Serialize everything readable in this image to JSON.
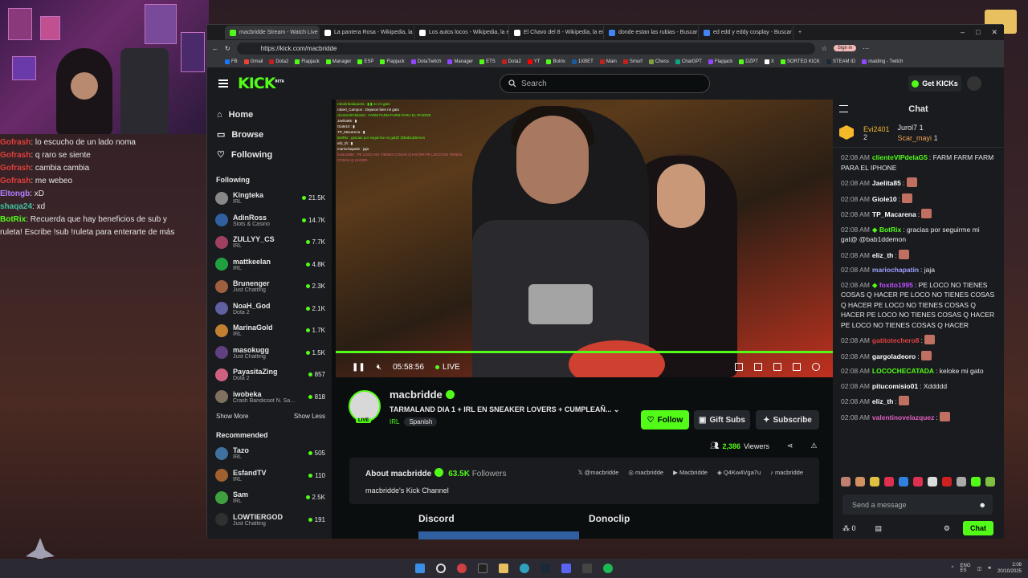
{
  "overlay_chat": [
    {
      "user": "Gofrash",
      "color": "#e0403a",
      "text": "lo escucho de un lado noma"
    },
    {
      "user": "Gofrash",
      "color": "#e0403a",
      "text": "q raro se siente"
    },
    {
      "user": "Gofrash",
      "color": "#e0403a",
      "text": "cambia cambia"
    },
    {
      "user": "Gofrash",
      "color": "#e0403a",
      "text": "me webeo"
    },
    {
      "user": "Eltongb",
      "color": "#b080ff",
      "text": "xD"
    },
    {
      "user": "shaqa24",
      "color": "#40c0a0",
      "text": "xd"
    },
    {
      "user": "BotRix",
      "color": "#53fc18",
      "text": "Recuerda que hay beneficios de sub y"
    },
    {
      "user": "",
      "color": "#ffffff",
      "text": "ruleta! Escribe !sub !ruleta para enterarte de más"
    }
  ],
  "browser": {
    "tabs": [
      {
        "label": "macbridde Stream - Watch Live o",
        "color": "#53fc18"
      },
      {
        "label": "La pantera Rosa - Wikipedia, la e",
        "color": "#ffffff"
      },
      {
        "label": "Los autos locos - Wikipedia, la e",
        "color": "#ffffff"
      },
      {
        "label": "El Chavo del 8 - Wikipedia, la en",
        "color": "#ffffff"
      },
      {
        "label": "donde estan las rubias - Buscar c",
        "color": "#4285f4"
      },
      {
        "label": "ed edd y eddy cosplay - Buscar c",
        "color": "#4285f4"
      }
    ],
    "url": "https://kick.com/macbridde",
    "signin": "Sign in",
    "bookmarks": [
      {
        "label": "FB",
        "color": "#1877f2"
      },
      {
        "label": "Gmail",
        "color": "#ea4335"
      },
      {
        "label": "Dota2",
        "color": "#c02020"
      },
      {
        "label": "Flapjack",
        "color": "#53fc18"
      },
      {
        "label": "Manager",
        "color": "#53fc18"
      },
      {
        "label": "ESP",
        "color": "#53fc18"
      },
      {
        "label": "Flapjack",
        "color": "#53fc18"
      },
      {
        "label": "DotaTwitch",
        "color": "#9146ff"
      },
      {
        "label": "Manager",
        "color": "#9146ff"
      },
      {
        "label": "ETS",
        "color": "#53fc18"
      },
      {
        "label": "Dota2",
        "color": "#c02020"
      },
      {
        "label": "YT",
        "color": "#ff0000"
      },
      {
        "label": "Botrix",
        "color": "#53fc18"
      },
      {
        "label": "1XBET",
        "color": "#1a5aa0"
      },
      {
        "label": "Main",
        "color": "#c02020"
      },
      {
        "label": "Smurf",
        "color": "#c02020"
      },
      {
        "label": "Chess",
        "color": "#80a040"
      },
      {
        "label": "ChatGPT",
        "color": "#10a37f"
      },
      {
        "label": "Flapjack",
        "color": "#9146ff"
      },
      {
        "label": "DZPT",
        "color": "#53fc18"
      },
      {
        "label": "X",
        "color": "#ffffff"
      },
      {
        "label": "SORTEO KICK",
        "color": "#53fc18"
      },
      {
        "label": "STEAM ID",
        "color": "#1b2838"
      },
      {
        "label": "malding - Twitch",
        "color": "#9146ff"
      }
    ]
  },
  "kick": {
    "logo": "KICK",
    "logo_beta": "BETA",
    "search_placeholder": "Search",
    "get_kicks": "Get KICKs",
    "nav": [
      {
        "label": "Home",
        "icon": "home-icon"
      },
      {
        "label": "Browse",
        "icon": "browse-icon"
      },
      {
        "label": "Following",
        "icon": "heart-icon"
      }
    ],
    "following_title": "Following",
    "following": [
      {
        "name": "Kingteka",
        "cat": "IRL",
        "count": "21.5K",
        "color": "#888"
      },
      {
        "name": "AdinRoss",
        "cat": "Slots & Casino",
        "count": "14.7K",
        "color": "#3060a0"
      },
      {
        "name": "ZULLYY_CS",
        "cat": "IRL",
        "count": "7.7K",
        "color": "#a04060"
      },
      {
        "name": "mattkeelan",
        "cat": "IRL",
        "count": "4.8K",
        "color": "#20a040"
      },
      {
        "name": "Brunenger",
        "cat": "Just Chatting",
        "count": "2.3K",
        "color": "#a06040"
      },
      {
        "name": "NoaH_God",
        "cat": "Dota 2",
        "count": "2.1K",
        "color": "#6060a0"
      },
      {
        "name": "MarinaGold",
        "cat": "IRL",
        "count": "1.7K",
        "color": "#c08030"
      },
      {
        "name": "masokugg",
        "cat": "Just Chatting",
        "count": "1.5K",
        "color": "#604080"
      },
      {
        "name": "PayasitaZing",
        "cat": "Dota 2",
        "count": "857",
        "color": "#d06080"
      },
      {
        "name": "iwobeka",
        "cat": "Crash Bandicoot N. Sa...",
        "count": "818",
        "color": "#807060"
      }
    ],
    "show_more": "Show More",
    "show_less": "Show Less",
    "recommended_title": "Recommended",
    "recommended": [
      {
        "name": "Tazo",
        "cat": "IRL",
        "count": "505",
        "color": "#4070a0"
      },
      {
        "name": "EsfandTV",
        "cat": "IRL",
        "count": "110",
        "color": "#a06030"
      },
      {
        "name": "Sam",
        "cat": "IRL",
        "count": "2.5K",
        "color": "#40a040"
      },
      {
        "name": "LOWTIERGOD",
        "cat": "Just Chatting",
        "count": "191",
        "color": "#303030"
      }
    ],
    "player": {
      "time": "05:58:56",
      "live": "LIVE",
      "progress": 1.0
    },
    "streamer": {
      "name": "macbridde",
      "live_badge": "LIVE",
      "title": "TARMALAND DIA 1 + IRL EN SNEAKER LOVERS + CUMPLEAÑ...",
      "category": "IRL",
      "tag": "Spanish",
      "viewers": "2,386",
      "viewers_label": "Viewers"
    },
    "buttons": {
      "follow": "Follow",
      "gift": "Gift Subs",
      "subscribe": "Subscribe"
    },
    "about": {
      "heading": "About macbridde",
      "followers": "63.5K",
      "followers_label": "Followers",
      "description": "macbridde's Kick Channel",
      "socials": [
        "@macbridde",
        "macbridde",
        "Macbridde",
        "Q4Kw4Vga7u",
        "macbridde"
      ]
    },
    "panels": [
      "Discord",
      "Donoclip"
    ],
    "chat": {
      "title": "Chat",
      "leaders": [
        {
          "name": "Evi2401",
          "count": "2"
        },
        {
          "name": "Jurol7",
          "count": "1"
        },
        {
          "name": "Scar_mayi",
          "count": "1"
        }
      ],
      "messages": [
        {
          "time": "02:08 AM",
          "user": "clienteVIPdelaG5",
          "color": "#53fc18",
          "text": "FARM FARM FARM PARA EL IPHONE"
        },
        {
          "time": "02:08 AM",
          "user": "Jaelita85",
          "color": "#ffffff",
          "text": ""
        },
        {
          "time": "02:08 AM",
          "user": "Giole10",
          "color": "#ffffff",
          "text": ""
        },
        {
          "time": "02:08 AM",
          "user": "TP_Macarena",
          "color": "#ffffff",
          "text": ""
        },
        {
          "time": "02:08 AM",
          "user": "BotRix",
          "color": "#53fc18",
          "text": "gracias por seguirme mi gat@ @bab1ddemon"
        },
        {
          "time": "02:08 AM",
          "user": "eliz_th",
          "color": "#ffffff",
          "text": ""
        },
        {
          "time": "02:08 AM",
          "user": "mariochapatin",
          "color": "#a0a0ff",
          "text": "jaja"
        },
        {
          "time": "02:08 AM",
          "user": "foxito1995",
          "color": "#c050ff",
          "text": "PE LOCO NO TIENES COSAS Q HACER PE LOCO NO TIENES COSAS Q HACER PE LOCO NO TIENES COSAS Q HACER PE LOCO NO TIENES COSAS Q HACER PE LOCO NO TIENES COSAS Q HACER"
        },
        {
          "time": "02:08 AM",
          "user": "gatitotechero8",
          "color": "#e04040",
          "text": ""
        },
        {
          "time": "02:08 AM",
          "user": "gargoladeoro",
          "color": "#ffffff",
          "text": ""
        },
        {
          "time": "02:08 AM",
          "user": "LOCOCHECATADA",
          "color": "#53fc18",
          "text": "keloke mi gato"
        },
        {
          "time": "02:08 AM",
          "user": "pitucomisio01",
          "color": "#ffffff",
          "text": "Xddddd"
        },
        {
          "time": "02:08 AM",
          "user": "eliz_th",
          "color": "#ffffff",
          "text": ""
        },
        {
          "time": "02:08 AM",
          "user": "valentinovelazquez",
          "color": "#e060c0",
          "text": ""
        }
      ],
      "input_placeholder": "Send a message",
      "points": "0",
      "send": "Chat"
    }
  },
  "taskbar": {
    "lang": "ENG",
    "lang2": "ES",
    "time": "2:08",
    "date": "20/10/2025"
  }
}
